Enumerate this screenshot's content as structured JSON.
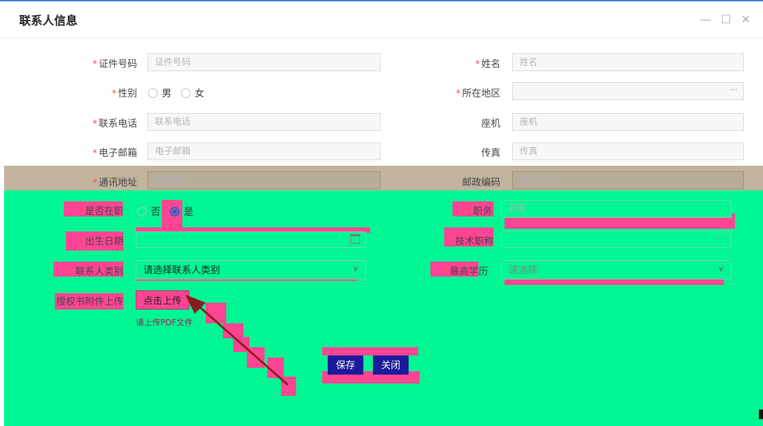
{
  "dialog": {
    "title": "联系人信息",
    "controls": {
      "minimize": "—",
      "maximize": "☐",
      "close": "✕"
    }
  },
  "form": {
    "required_mark": "*",
    "id_number": {
      "label": "证件号码",
      "placeholder": "证件号码"
    },
    "name": {
      "label": "姓名",
      "placeholder": "姓名"
    },
    "gender": {
      "label": "性别",
      "options": [
        "男",
        "女"
      ]
    },
    "region": {
      "label": "所在地区",
      "more": "···"
    },
    "phone": {
      "label": "联系电话",
      "placeholder": "联系电话"
    },
    "landline": {
      "label": "座机",
      "placeholder": "座机"
    },
    "email": {
      "label": "电子邮箱",
      "placeholder": "电子邮箱"
    },
    "fax": {
      "label": "传真",
      "placeholder": "传真"
    },
    "address": {
      "label": "通讯地址",
      "placeholder": "通讯地址"
    },
    "postcode": {
      "label": "邮政编码",
      "placeholder": "邮政编码"
    },
    "employed": {
      "label": "是否在职",
      "options": [
        "否",
        "是"
      ],
      "selected": "是"
    },
    "position": {
      "label": "职务",
      "placeholder": "职务"
    },
    "birth_date": {
      "label": "出生日期",
      "calendar_icon": "calendar-icon"
    },
    "tech_title": {
      "label": "技术职称",
      "more": "···"
    },
    "contact_type": {
      "label": "联系人类别",
      "value": "请选择联系人类别",
      "chevron": "∨"
    },
    "education": {
      "label": "最高学历",
      "value": "请选择",
      "chevron": "∨"
    },
    "attachment": {
      "label": "授权书附件上传",
      "button": "点击上传",
      "hint": "请上传PDF文件"
    }
  },
  "actions": {
    "save": "保存",
    "close": "关闭"
  },
  "colors": {
    "accent": "#1b66d6",
    "overlay_green": "#00f693",
    "overlay_magenta": "#fe4594",
    "required": "#ff4d4f"
  }
}
